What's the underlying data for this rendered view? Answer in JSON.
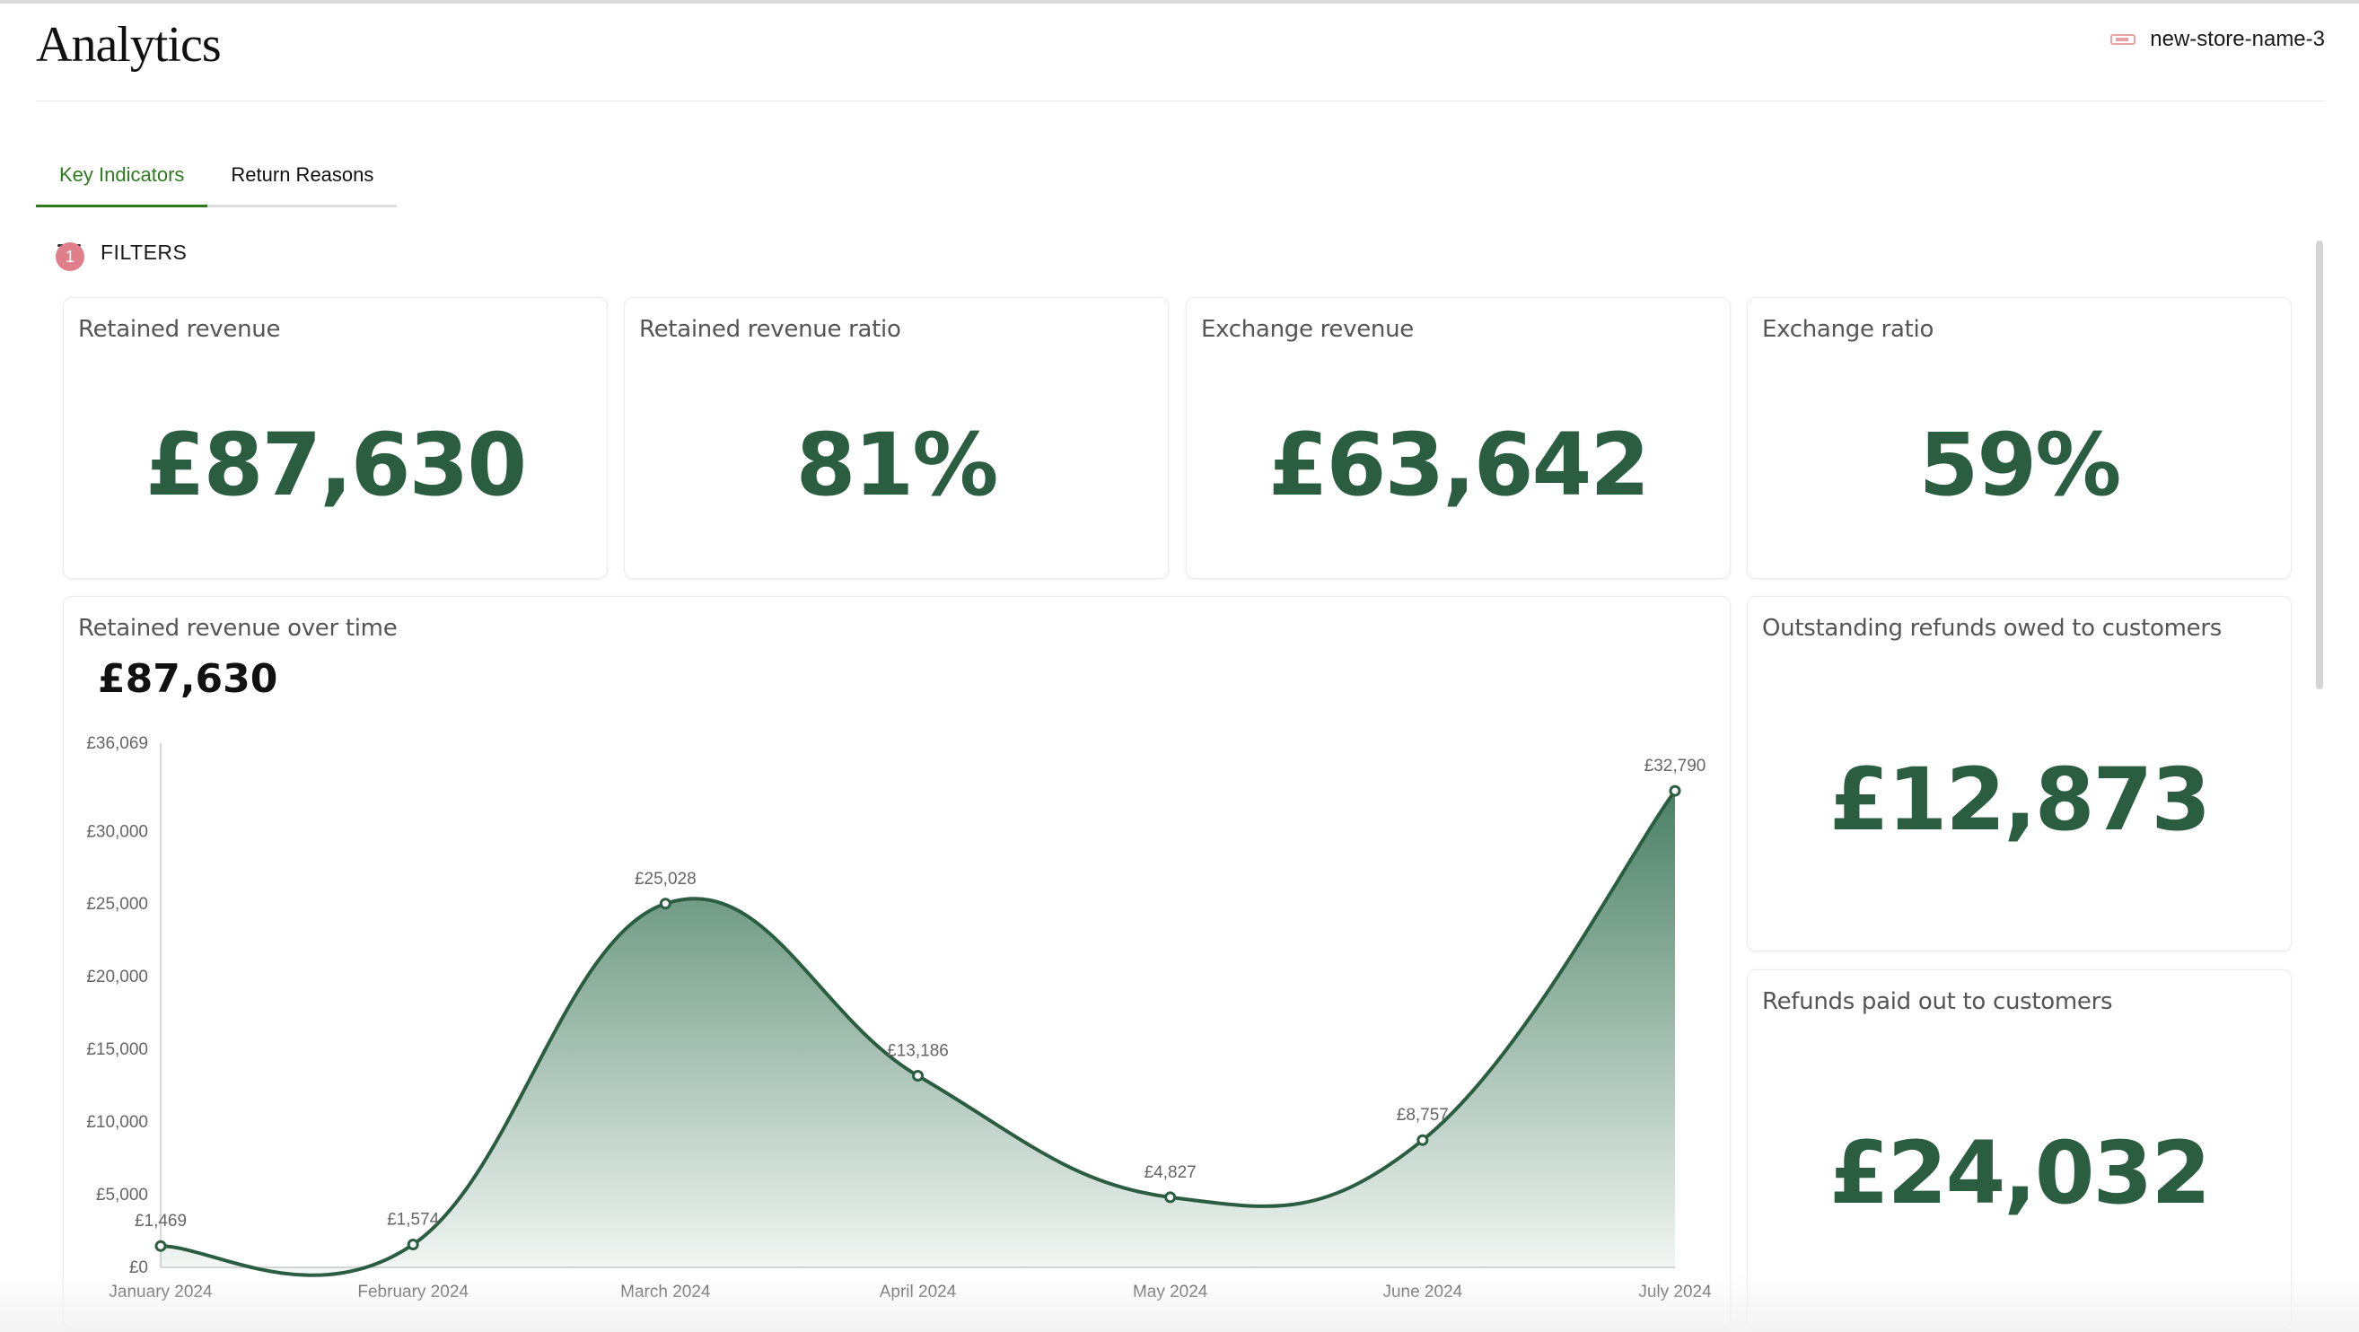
{
  "header": {
    "title": "Analytics",
    "store_name": "new-store-name-3"
  },
  "tabs": [
    {
      "label": "Key Indicators",
      "active": true
    },
    {
      "label": "Return Reasons",
      "active": false
    }
  ],
  "filters": {
    "label": "FILTERS",
    "count": "1"
  },
  "cards": {
    "retained_revenue": {
      "title": "Retained revenue",
      "value": "£87,630"
    },
    "retained_revenue_ratio": {
      "title": "Retained revenue ratio",
      "value": "81%"
    },
    "exchange_revenue": {
      "title": "Exchange revenue",
      "value": "£63,642"
    },
    "exchange_ratio": {
      "title": "Exchange ratio",
      "value": "59%"
    },
    "outstanding_refunds": {
      "title": "Outstanding refunds owed to customers",
      "value": "£12,873"
    },
    "refunds_paid": {
      "title": "Refunds paid out to customers",
      "value": "£24,032"
    }
  },
  "chart_card": {
    "title": "Retained revenue over time",
    "total": "£87,630"
  },
  "colors": {
    "accent": "#2f7a1f",
    "value_green": "#2b5d40",
    "badge": "#e07f8a"
  },
  "chart_data": {
    "type": "area",
    "categories": [
      "January 2024",
      "February 2024",
      "March 2024",
      "April 2024",
      "May 2024",
      "June 2024",
      "July 2024"
    ],
    "values": [
      1469,
      1574,
      25028,
      13186,
      4827,
      8757,
      32790
    ],
    "data_labels": [
      "£1,469",
      "£1,574",
      "£25,028",
      "£13,186",
      "£4,827",
      "£8,757",
      "£32,790"
    ],
    "y_ticks": [
      0,
      5000,
      10000,
      15000,
      20000,
      25000,
      30000,
      36069
    ],
    "y_tick_labels": [
      "£0",
      "£5,000",
      "£10,000",
      "£15,000",
      "£20,000",
      "£25,000",
      "£30,000",
      "£36,069"
    ],
    "ylim": [
      0,
      36069
    ],
    "grid": false,
    "title": "Retained revenue over time"
  }
}
